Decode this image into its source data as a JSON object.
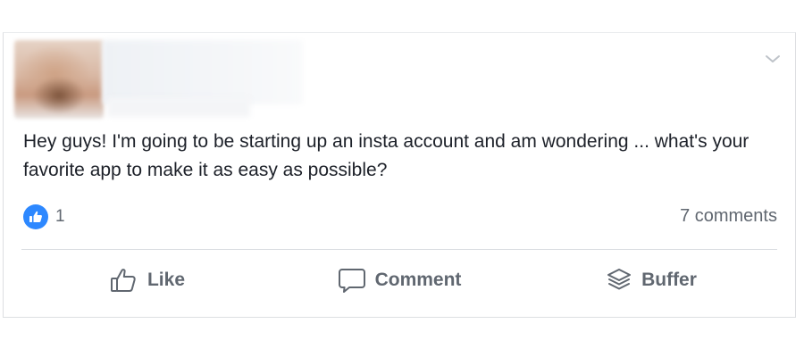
{
  "post": {
    "text": "Hey guys! I'm going to be starting up an insta account and am wondering ... what's your favorite app to make it as easy as possible?",
    "reaction_count": "1",
    "comments_label": "7 comments"
  },
  "actions": {
    "like_label": "Like",
    "comment_label": "Comment",
    "buffer_label": "Buffer"
  },
  "icons": {
    "reaction": "like-reaction-icon",
    "like": "thumbs-up-icon",
    "comment": "speech-bubble-icon",
    "buffer": "stacked-layers-icon",
    "menu": "chevron-down-icon"
  },
  "colors": {
    "accent": "#2d88ff",
    "text": "#1d2129",
    "secondary_text": "#606770",
    "divider": "#dadde1"
  }
}
